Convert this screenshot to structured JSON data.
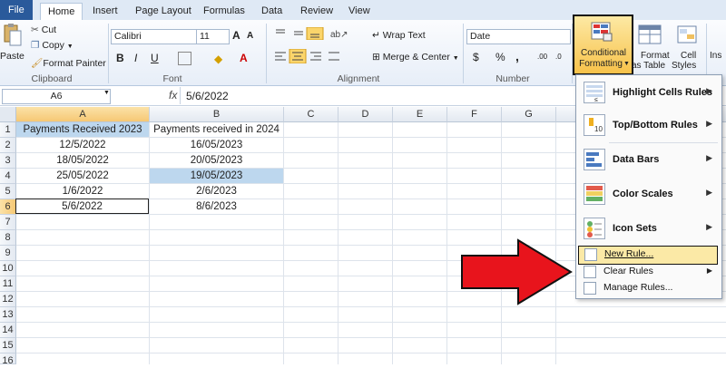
{
  "tabs": [
    "File",
    "Home",
    "Insert",
    "Page Layout",
    "Formulas",
    "Data",
    "Review",
    "View"
  ],
  "clipboard": {
    "paste": "Paste",
    "cut": "Cut",
    "copy": "Copy",
    "format_painter": "Format Painter",
    "group": "Clipboard"
  },
  "font": {
    "name": "Calibri",
    "size": "11",
    "bold": "B",
    "italic": "I",
    "underline": "U",
    "group": "Font",
    "grow": "A",
    "shrink": "A",
    "color_letter": "A"
  },
  "alignment": {
    "wrap_text": "Wrap Text",
    "merge_center": "Merge & Center",
    "group": "Alignment"
  },
  "number": {
    "format": "Date",
    "currency": "$",
    "percent": "%",
    "comma": ",",
    "inc_dec": ".00",
    "dec_dec": ".0",
    "group": "Number"
  },
  "styles": {
    "conditional_formatting_1": "Conditional",
    "conditional_formatting_2": "Formatting",
    "format_table_1": "Format",
    "format_table_2": "as Table",
    "cell_styles_1": "Cell",
    "cell_styles_2": "Styles",
    "insert": "Ins"
  },
  "formula_bar": {
    "name_box": "A6",
    "fx": "fx",
    "value": "5/6/2022"
  },
  "columns": [
    "A",
    "B",
    "C",
    "D",
    "E",
    "F",
    "G"
  ],
  "rows": [
    "1",
    "2",
    "3",
    "4",
    "5",
    "6",
    "7",
    "8",
    "9",
    "10",
    "11",
    "12",
    "13",
    "14",
    "15",
    "16"
  ],
  "cells": {
    "A": [
      "Payments Received 2023",
      "12/5/2022",
      "18/05/2022",
      "25/05/2022",
      "1/6/2022",
      "5/6/2022"
    ],
    "B": [
      "Payments received in 2024",
      "16/05/2023",
      "20/05/2023",
      "19/05/2023",
      "2/6/2023",
      "8/6/2023"
    ]
  },
  "colors": {
    "header_highlight": "#bdd7ee",
    "accent": "#2a5a9b",
    "arrow": "#e8141c",
    "menu_hover": "#fbe9a6"
  },
  "menu": {
    "items": [
      "Highlight Cells Rules",
      "Top/Bottom Rules",
      "Data Bars",
      "Color Scales",
      "Icon Sets"
    ],
    "small_items": [
      "New Rule...",
      "Clear Rules",
      "Manage Rules..."
    ]
  }
}
